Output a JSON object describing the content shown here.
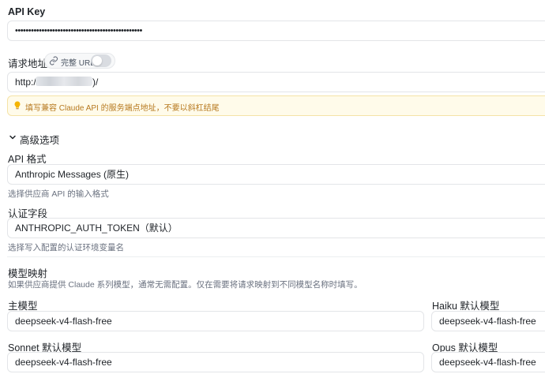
{
  "api_key": {
    "label": "API Key",
    "value": "••••••••••••••••••••••••••••••••••••••••••••••••"
  },
  "endpoint": {
    "label": "请求地址",
    "full_url_label": "完整 URL",
    "full_url_enabled": false,
    "value_prefix": "http://",
    "value_suffix": ")/",
    "hint": "填写兼容 Claude API 的服务端点地址，不要以斜杠结尾"
  },
  "advanced": {
    "title": "高级选项",
    "api_format": {
      "label": "API 格式",
      "value": "Anthropic Messages (原生)",
      "help": "选择供应商 API 的输入格式"
    },
    "auth_field": {
      "label": "认证字段",
      "value": "ANTHROPIC_AUTH_TOKEN（默认）",
      "help": "选择写入配置的认证环境变量名"
    },
    "model_mapping": {
      "title": "模型映射",
      "help": "如果供应商提供 Claude 系列模型，通常无需配置。仅在需要将请求映射到不同模型名称时填写。",
      "main_model": {
        "label": "主模型",
        "value": "deepseek-v4-flash-free"
      },
      "haiku_model": {
        "label": "Haiku 默认模型",
        "value": "deepseek-v4-flash-free"
      },
      "sonnet_model": {
        "label": "Sonnet 默认模型",
        "value": "deepseek-v4-flash-free"
      },
      "opus_model": {
        "label": "Opus 默认模型",
        "value": "deepseek-v4-flash-free"
      }
    }
  },
  "colors": {
    "hint_text": "#b7791f",
    "hint_bg": "#fffbea",
    "hint_border": "#f5e3a6",
    "toggle_off": "#d9dce1"
  }
}
